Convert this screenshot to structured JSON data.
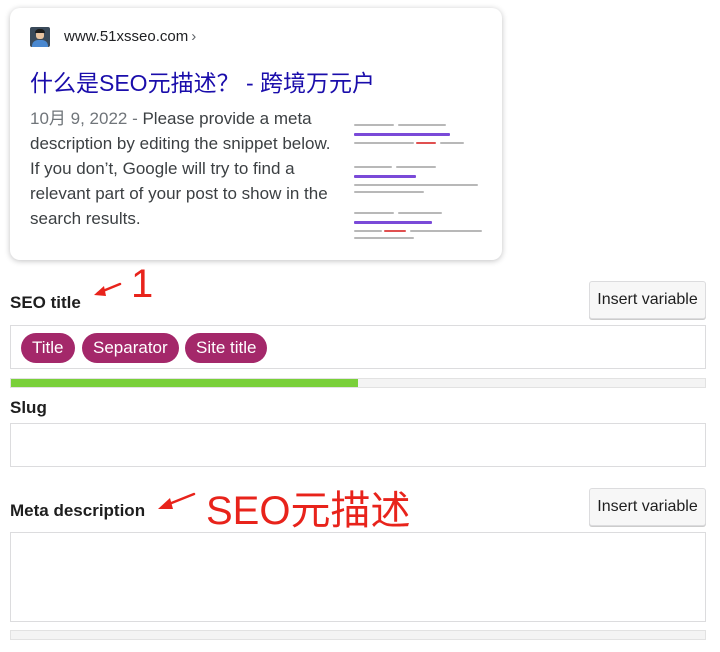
{
  "preview": {
    "url": "www.51xsseo.com",
    "url_chevron": "›",
    "title": "什么是SEO元描述？ - 跨境万元户",
    "date": "10月 9, 2022",
    "date_sep": " - ",
    "description": "Please provide a meta description by editing the snippet below. If you don’t, Google will try to find a relevant part of your post to show in the search results."
  },
  "seo_title": {
    "label": "SEO title",
    "insert_variable": "Insert variable",
    "pills": [
      "Title",
      "Separator",
      "Site title"
    ],
    "progress": 0.5,
    "progress_color": "#7ad03a"
  },
  "slug": {
    "label": "Slug",
    "value": ""
  },
  "meta_description": {
    "label": "Meta description",
    "insert_variable": "Insert variable",
    "value": ""
  },
  "annotations": {
    "seo_title_note": "1",
    "meta_description_note": "SEO元描述",
    "color": "#e8231b"
  }
}
